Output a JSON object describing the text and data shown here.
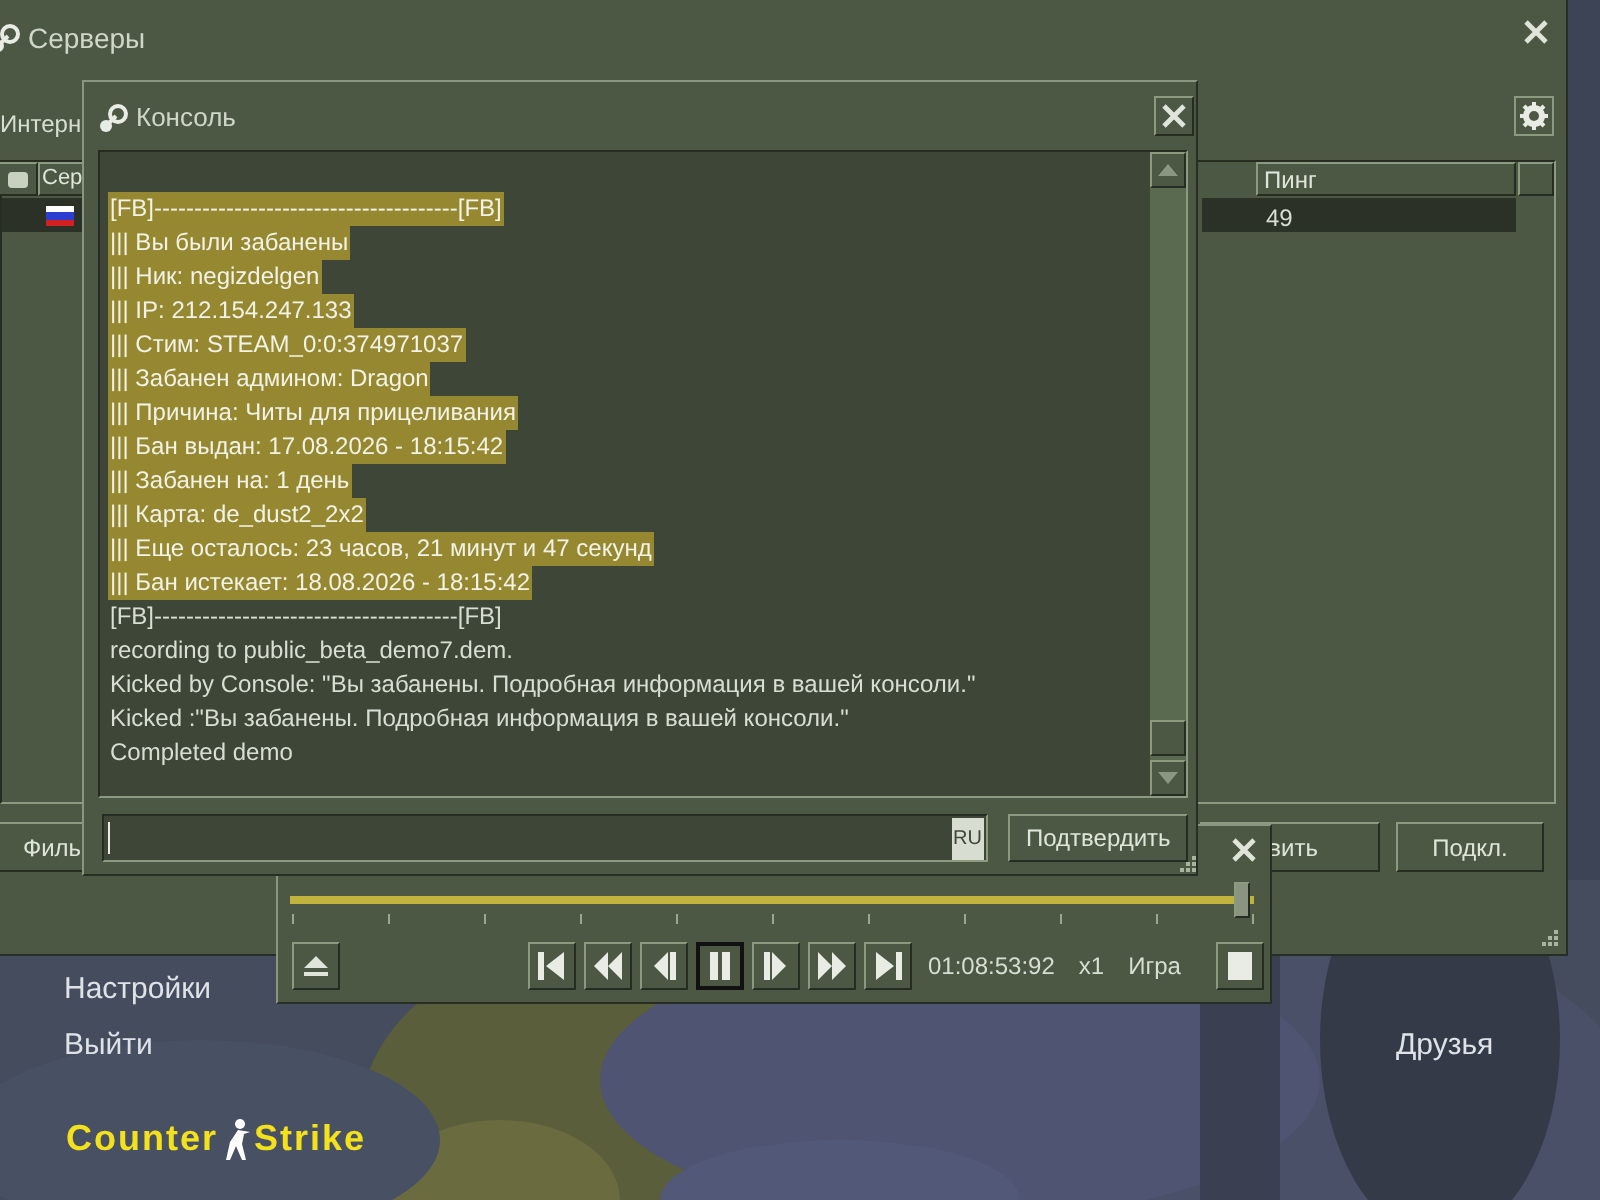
{
  "servers_window": {
    "title": "Серверы",
    "tab": "Интерн",
    "columns": [
      "Сер",
      "Пинг"
    ],
    "rows": [
      {
        "ping": "49",
        "selected": true
      }
    ],
    "buttons": [
      "Филь",
      "вить",
      "Подкл."
    ]
  },
  "console": {
    "title": "Консоль",
    "lines": [
      {
        "text": "[FB]--------------------------------------[FB]",
        "highlighted": true
      },
      {
        "text": "||| Вы были забанены",
        "highlighted": true
      },
      {
        "text": "||| Ник: negizdelgen",
        "highlighted": true
      },
      {
        "text": "||| IP: 212.154.247.133",
        "highlighted": true
      },
      {
        "text": "||| Стим: STEAM_0:0:374971037",
        "highlighted": true
      },
      {
        "text": "||| Забанен админом: Dragon",
        "highlighted": true
      },
      {
        "text": "||| Причина: Читы для прицеливания",
        "highlighted": true
      },
      {
        "text": "||| Бан выдан: 17.08.2026 - 18:15:42",
        "highlighted": true
      },
      {
        "text": "||| Забанен на: 1 день",
        "highlighted": true
      },
      {
        "text": "||| Карта: de_dust2_2x2",
        "highlighted": true
      },
      {
        "text": "||| Еще осталось: 23 часов, 21 минут и 47 секунд",
        "highlighted": true
      },
      {
        "text": "||| Бан истекает: 18.08.2026 - 18:15:42",
        "highlighted": true
      },
      {
        "text": "[FB]--------------------------------------[FB]",
        "highlighted": false
      },
      {
        "text": "recording to public_beta_demo7.dem.",
        "highlighted": false
      },
      {
        "text": "Kicked by Console: \"Вы забанены. Подробная информация в вашей консоли.\"",
        "highlighted": false
      },
      {
        "text": "Kicked :\"Вы забанены. Подробная информация в вашей консоли.\"",
        "highlighted": false
      },
      {
        "text": "Completed demo",
        "highlighted": false
      }
    ],
    "input_language": "RU",
    "submit_button": "Подтвердить"
  },
  "demo_player": {
    "level": 1.0,
    "transport": [
      {
        "kind": "skip_start",
        "selected": false
      },
      {
        "kind": "rewind",
        "selected": false
      },
      {
        "kind": "step_back",
        "selected": false
      },
      {
        "kind": "pause",
        "selected": true
      },
      {
        "kind": "step_forward",
        "selected": false
      },
      {
        "kind": "fast_forward",
        "selected": false
      },
      {
        "kind": "skip_end",
        "selected": false
      }
    ],
    "time": "01:08:53:92",
    "speed": "x1",
    "mode": "Игра"
  },
  "menu": [
    "Настройки",
    "Выйти"
  ],
  "friends": "Друзья",
  "logo": [
    "Counter",
    "Strike"
  ]
}
